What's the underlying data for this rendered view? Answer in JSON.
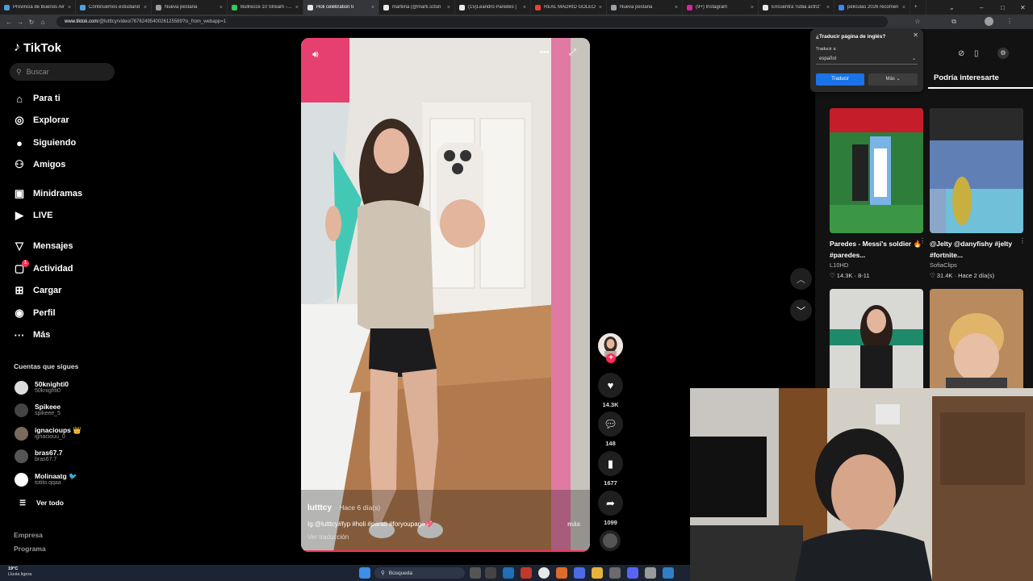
{
  "browser": {
    "tabs": [
      {
        "label": "Provincia de Buenos Air",
        "color": "#4a9eda"
      },
      {
        "label": "Continuemos estudiand",
        "color": "#4aa3df"
      },
      {
        "label": "Nueva pestaña",
        "color": "#9aa0a6"
      },
      {
        "label": "Bullrecce 10 Stream - Wi",
        "color": "#34c759"
      },
      {
        "label": "Holi celebration ti",
        "color": "#e8e8e8",
        "active": true
      },
      {
        "label": "martiina (@marti.sctun",
        "color": "#e8e8e8"
      },
      {
        "label": "(15)Leandro Paredes |",
        "color": "#e8e8e8"
      },
      {
        "label": "REAL MADRID GOLEO",
        "color": "#ea4335"
      },
      {
        "label": "Nueva pestaña",
        "color": "#9aa0a6"
      },
      {
        "label": "(9+) Instagram",
        "color": "#d6249f"
      },
      {
        "label": "Encuentra 'rubia actriz'",
        "color": "#e8e8e8"
      },
      {
        "label": "peliculas 2026 recomen",
        "color": "#4285f4"
      }
    ],
    "url_host": "www.tiktok.com",
    "url_path": "/@lutttcy/video/7676249540026125589?is_from_webapp=1"
  },
  "sidebar": {
    "logo": "TikTok",
    "search_placeholder": "Buscar",
    "nav": [
      {
        "label": "Para ti",
        "icon": "home-icon",
        "glyph": "⌂"
      },
      {
        "label": "Explorar",
        "icon": "compass-icon",
        "glyph": "◎"
      },
      {
        "label": "Siguiendo",
        "icon": "following-icon",
        "glyph": "●"
      },
      {
        "label": "Amigos",
        "icon": "friends-icon",
        "glyph": "⚇"
      },
      {
        "label": "Minidramas",
        "icon": "minidramas-icon",
        "glyph": "▣"
      },
      {
        "label": "LIVE",
        "icon": "live-icon",
        "glyph": "▶"
      },
      {
        "label": "Mensajes",
        "icon": "messages-icon",
        "glyph": "▽"
      },
      {
        "label": "Actividad",
        "icon": "activity-icon",
        "glyph": "▢"
      },
      {
        "label": "Cargar",
        "icon": "upload-icon",
        "glyph": "⊞"
      },
      {
        "label": "Perfil",
        "icon": "profile-icon",
        "glyph": "◉"
      },
      {
        "label": "Más",
        "icon": "more-icon",
        "glyph": "···"
      }
    ],
    "activity_badge": "1",
    "following_heading": "Cuentas que sigues",
    "following": [
      {
        "name": "50knighti0",
        "handle": "50knighti0",
        "color": "#ddd"
      },
      {
        "name": "Spikeee",
        "handle": "spikeee_5",
        "color": "#444"
      },
      {
        "name": "ignacioups 👑",
        "handle": "ignaciouu_0",
        "color": "#7a6a5c"
      },
      {
        "name": "bras67.7",
        "handle": "bras67.7",
        "color": "#555"
      },
      {
        "name": "Molinaatg 🐦",
        "handle": "totito.qqaa",
        "color": "#fff"
      }
    ],
    "see_all": "Ver todo",
    "footer": [
      "Empresa",
      "Programa"
    ]
  },
  "video": {
    "author": "lutttcy",
    "time": "· Hace 6 día(s)",
    "caption": "Ig:@lutttcy#fyp #holi #parati #foryoupage💖",
    "more": "más",
    "translation": "Ver traducción"
  },
  "actions": {
    "likes": "14.3K",
    "comments": "148",
    "saves": "1677",
    "shares": "1099"
  },
  "right_panel": {
    "title": "Podría interesarte",
    "cards": [
      {
        "caption": "Paredes - Messi's soldier 🔥 #paredes...",
        "channel": "L10HD",
        "stats": "♡ 14.3K · 8-11"
      },
      {
        "caption": "@Jelty @danyfishy #jelty #fortnite...",
        "channel": "SofiaClips",
        "stats": "♡ 31.4K · Hace 2 día(s)"
      },
      {
        "caption": "",
        "channel": "",
        "stats": ""
      },
      {
        "caption": "",
        "channel": "",
        "stats": ""
      }
    ]
  },
  "translate_popup": {
    "title": "¿Traducir página de inglés?",
    "label": "Traducir a",
    "language": "español",
    "translate_button": "Traducir",
    "more_button": "Más"
  },
  "taskbar": {
    "temp": "19°C",
    "weather": "Lluvia ligera",
    "search": "Búsqueda"
  }
}
